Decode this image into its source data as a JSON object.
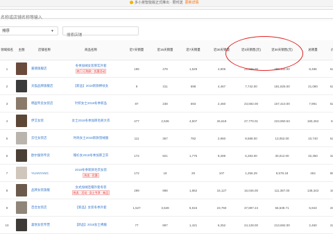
{
  "top_notice": {
    "text": "多小弟智能版正式推出 · 限时送",
    "link": "更新详情"
  },
  "search": {
    "placeholder": "名称或店铺名称等输入"
  },
  "filter": {
    "select_value": "排序",
    "input_placeholder": "搜索店铺"
  },
  "table": {
    "headers": [
      "领域排名",
      "主图",
      "店铺名称",
      "商品名称",
      "近7天销量",
      "近15天销量",
      "近7天销量",
      "近30天销量",
      "近3天销售(元)",
      "近30天销售(元)",
      "总销量",
      "价格"
    ],
    "rows": [
      {
        "rank": "1",
        "thumb_color": "#6a4a3a",
        "seller": "嘉德旗舰店",
        "product": "冬季加绒女装厚实外套",
        "tag": "热门 订购款 · 优惠活动",
        "c1": "195",
        "c2": "479",
        "c3": "1,529",
        "c4": "4,805",
        "c5": "22,626.00",
        "c6": "288,160.00",
        "c7": "8,486",
        "c8": "62.00"
      },
      {
        "rank": "2",
        "thumb_color": "#3b3b3b",
        "seller": "天猫品牌旗舰店",
        "product": "【新品】2018新款棉袄女",
        "tag": "",
        "c1": "9",
        "c2": "311",
        "c3": "598",
        "c4": "4,467",
        "c5": "7,742.00",
        "c6": "181,825.00",
        "c7": "21,080",
        "c8": "62.00"
      },
      {
        "rank": "3",
        "thumb_color": "#8a7a6a",
        "seller": "韩国专卖女装店",
        "product": "针织女士2018冬季新品",
        "tag": "",
        "c1": "87",
        "c2": "238",
        "c3": "593",
        "c4": "2,460",
        "c5": "23,592.00",
        "c6": "157,410.00",
        "c7": "7,991",
        "c8": "62.00"
      },
      {
        "rank": "4",
        "thumb_color": "#5c4636",
        "seller": "伊艾女装",
        "product": "女士2018冬季加厚毛呢大衣",
        "tag": "",
        "c1": "477",
        "c2": "2,536",
        "c3": "4,507",
        "c4": "26,618",
        "c5": "27,770.01",
        "c6": "223,950.53",
        "c7": "180,453",
        "c8": "8.41"
      },
      {
        "rank": "5",
        "thumb_color": "#b9b4ad",
        "seller": "云仕女装店",
        "product": "时尚女士2018新款羽绒服",
        "tag": "",
        "c1": "111",
        "c2": "367",
        "c3": "782",
        "c4": "2,960",
        "c5": "8,588.00",
        "c6": "13,052.00",
        "c7": "10,740",
        "c8": "62.00"
      },
      {
        "rank": "6",
        "thumb_color": "#4a4036",
        "seller": "欧尔服饰专卖",
        "product": "帽衫女2018冬季加厚卫衣",
        "tag": "",
        "c1": "172",
        "c2": "921",
        "c3": "1,775",
        "c4": "9,289",
        "c5": "6,283.00",
        "c6": "30,012.00",
        "c7": "32,350",
        "c8": "32.00"
      },
      {
        "rank": "7",
        "thumb_color": "#cfc6bc",
        "seller": "YUANYANG",
        "product": "2018冬季新款毛衣女装",
        "tag": "热卖 · 优惠",
        "c1": "172",
        "c2": "18",
        "c3": "29",
        "c4": "107",
        "c5": "1,256.29",
        "c6": "9,578.18",
        "c7": "454",
        "c8": "88.00"
      },
      {
        "rank": "8",
        "thumb_color": "#6b5a4c",
        "seller": "品牌女装旗舰",
        "product": "女式加绒连帽外套冬装",
        "tag": "热卖 · 活动 · 女士专享 · 新品",
        "c1": "299",
        "c2": "998",
        "c3": "1,862",
        "c4": "15,127",
        "c5": "16,046.00",
        "c6": "111,387.00",
        "c7": "138,343",
        "c8": "18.00"
      },
      {
        "rank": "9",
        "thumb_color": "#8f8579",
        "seller": "百合女装店",
        "product": "【新品】女装冬季外套",
        "tag": "",
        "c1": "1,527",
        "c2": "3,628",
        "c3": "5,915",
        "c4": "23,750",
        "c5": "37,897.24",
        "c6": "56,639.71",
        "c7": "5,943",
        "c8": "28.00"
      },
      {
        "rank": "10",
        "thumb_color": "#3e3a38",
        "seller": "喜悦女装专营",
        "product": "【新品】2018女士棉服",
        "tag": "",
        "c1": "77",
        "c2": "897",
        "c3": "1,421",
        "c4": "6,252",
        "c5": "24,128.00",
        "c6": "213,692.00",
        "c7": "2,460",
        "c8": "22.00"
      }
    ]
  }
}
